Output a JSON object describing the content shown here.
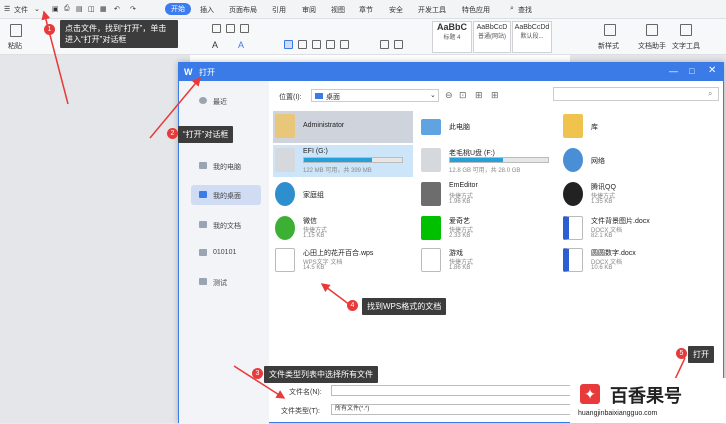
{
  "menubar": {
    "file_label": "文件",
    "tabs": [
      "开始",
      "插入",
      "页面布局",
      "引用",
      "审阅",
      "视图",
      "章节",
      "安全",
      "开发工具",
      "特色应用"
    ],
    "search_label": "查找"
  },
  "ribbon": {
    "paste_label": "粘贴",
    "styles": [
      {
        "sample": "AaBbC",
        "name": "标题 4"
      },
      {
        "sample": "AaBbCcD",
        "name": "普通(网站)"
      },
      {
        "sample": "AaBbCcDd",
        "name": "默认段..."
      }
    ],
    "new_style_label": "新样式",
    "doc_helper_label": "文档助手",
    "text_tools_label": "文字工具"
  },
  "dialog": {
    "title": "打开",
    "sidebar": [
      {
        "label": "最近"
      },
      {
        "label": "我的电脑"
      },
      {
        "label": "我的桌面"
      },
      {
        "label": "我的文档"
      },
      {
        "label": "010101"
      },
      {
        "label": "测试"
      }
    ],
    "location_label": "位置(I):",
    "location_value": "桌面",
    "files": [
      {
        "name": "Administrator",
        "type": "",
        "size": "",
        "icon": "user-folder-icon"
      },
      {
        "name": "此电脑",
        "type": "",
        "size": "",
        "icon": "computer-icon"
      },
      {
        "name": "库",
        "type": "",
        "size": "",
        "icon": "library-folder-icon"
      },
      {
        "name": "EFI (G:)",
        "type": "",
        "size": "122 MB 可用，共 399 MB",
        "icon": "drive-icon",
        "usage": 0.69
      },
      {
        "name": "老毛桃U盘 (F:)",
        "type": "",
        "size": "12.8 GB 可用，共 28.0 GB",
        "icon": "drive-icon",
        "usage": 0.54
      },
      {
        "name": "网络",
        "type": "",
        "size": "",
        "icon": "network-icon"
      },
      {
        "name": "家庭组",
        "type": "",
        "size": "",
        "icon": "homegroup-icon"
      },
      {
        "name": "EmEditor",
        "type": "快捷方式",
        "size": "1.96 KB",
        "icon": "emeditor-icon"
      },
      {
        "name": "腾讯QQ",
        "type": "快捷方式",
        "size": "1.35 KB",
        "icon": "qq-icon"
      },
      {
        "name": "微信",
        "type": "快捷方式",
        "size": "1.15 KB",
        "icon": "wechat-icon"
      },
      {
        "name": "爱奇艺",
        "type": "快捷方式",
        "size": "2.33 KB",
        "icon": "iqiyi-icon"
      },
      {
        "name": "文件背景图片.docx",
        "type": "DOCX 文档",
        "size": "82.1 KB",
        "icon": "docx-icon"
      },
      {
        "name": "心田上的花开百合.wps",
        "type": "WPS文字 文档",
        "size": "14.5 KB",
        "icon": "wps-icon"
      },
      {
        "name": "游戏",
        "type": "快捷方式",
        "size": "1.86 KB",
        "icon": "shortcut-icon"
      },
      {
        "name": "圆圆数字.docx",
        "type": "DOCX 文档",
        "size": "10.6 KB",
        "icon": "docx-icon"
      }
    ],
    "filename_label": "文件名(N):",
    "filename_value": "",
    "filetype_label": "文件类型(T):",
    "filetype_value": "所有文件(*.*)"
  },
  "callouts": [
    {
      "num": "1",
      "text": "点击文件，找到“打开”，单击进入“打开”对话框"
    },
    {
      "num": "2",
      "text": "“打开”对话框"
    },
    {
      "num": "3",
      "text": "文件类型列表中选择所有文件"
    },
    {
      "num": "4",
      "text": "找到WPS格式的文档"
    },
    {
      "num": "5",
      "text": "打开"
    }
  ],
  "watermark": {
    "brand": "百香果号",
    "url": "huangjinbaixiangguo.com"
  },
  "colors": {
    "accent": "#3b7be8",
    "callout_bg": "#3c3c3c",
    "marker": "#e83a3a"
  }
}
